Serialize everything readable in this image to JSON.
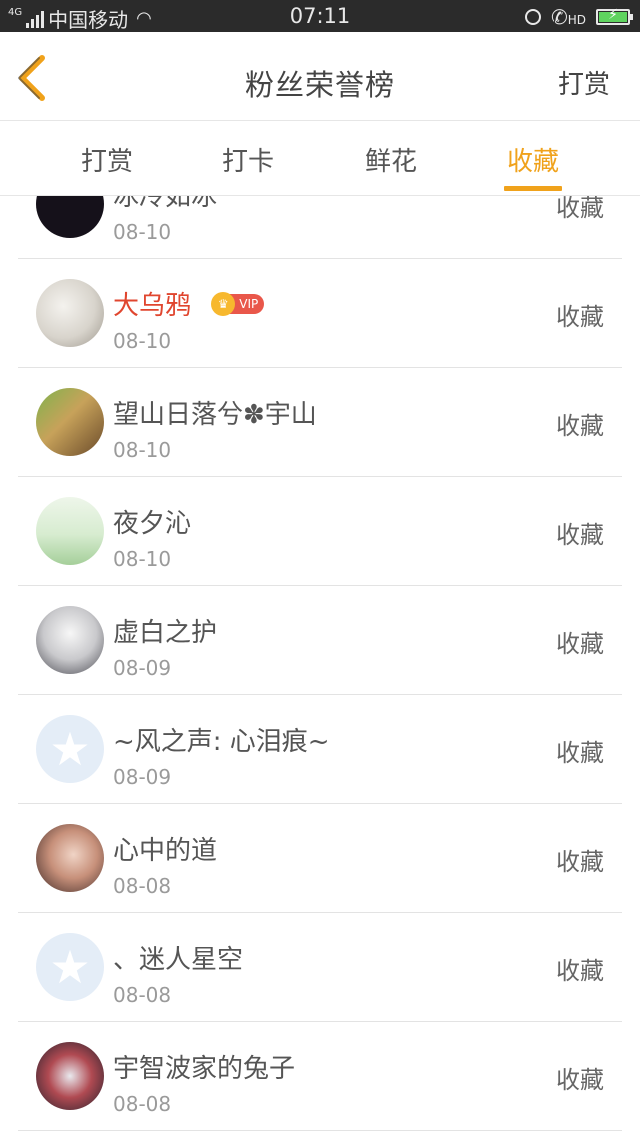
{
  "status_bar": {
    "network": "4G",
    "carrier": "中国移动",
    "time": "07:11",
    "hd_label": "HD",
    "battery_level": 1.0
  },
  "header": {
    "title": "粉丝荣誉榜",
    "right_button": "打赏"
  },
  "tabs": [
    {
      "label": "打赏",
      "active": false
    },
    {
      "label": "打卡",
      "active": false
    },
    {
      "label": "鲜花",
      "active": false
    },
    {
      "label": "收藏",
      "active": true
    }
  ],
  "colors": {
    "accent": "#f0a21b",
    "vip_name": "#e0462f"
  },
  "list": [
    {
      "name": "冰冷如冰",
      "date": "08-10",
      "action": "收藏",
      "avatar": "dark-avatar"
    },
    {
      "name": "大乌鸦",
      "date": "08-10",
      "action": "收藏",
      "avatar": "sketch-avatar",
      "vip": true,
      "vip_label": "VIP"
    },
    {
      "name": "望山日落兮✽宇山",
      "date": "08-10",
      "action": "收藏",
      "avatar": "kids-avatar"
    },
    {
      "name": "夜夕沁",
      "date": "08-10",
      "action": "收藏",
      "avatar": "leaf-avatar"
    },
    {
      "name": "虚白之护",
      "date": "08-09",
      "action": "收藏",
      "avatar": "anime-avatar"
    },
    {
      "name": "~风之声: 心泪痕~",
      "date": "08-09",
      "action": "收藏",
      "avatar": "qq-default-avatar"
    },
    {
      "name": "心中的道",
      "date": "08-08",
      "action": "收藏",
      "avatar": "girl-avatar"
    },
    {
      "name": "、迷人星空",
      "date": "08-08",
      "action": "收藏",
      "avatar": "qq-default-avatar"
    },
    {
      "name": "宇智波家的兔子",
      "date": "08-08",
      "action": "收藏",
      "avatar": "anime-red-avatar"
    }
  ]
}
